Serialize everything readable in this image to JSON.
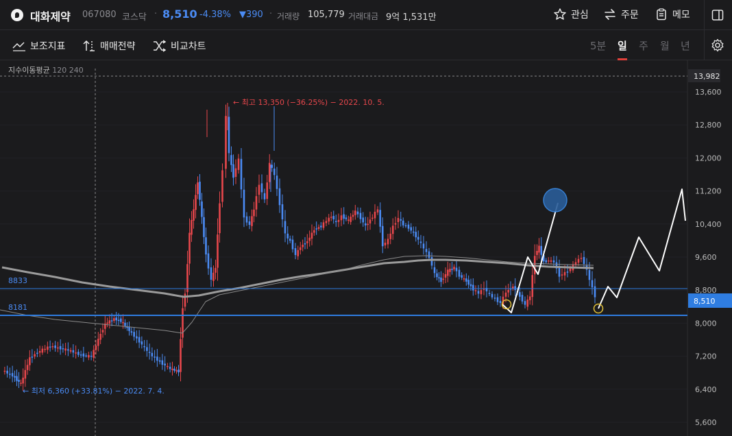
{
  "header": {
    "name": "대화제약",
    "code": "067080",
    "market": "코스닥",
    "price": "8,510",
    "change_rate": "-4.38%",
    "change": "▼390",
    "volume_label": "거래량",
    "volume": "105,779",
    "amount_label": "거래대금",
    "amount": "9억 1,531만",
    "favorite_label": "관심",
    "order_label": "주문",
    "memo_label": "메모"
  },
  "toolbar": {
    "indicator_label": "보조지표",
    "strategy_label": "매매전략",
    "compare_label": "비교차트",
    "periods": [
      "5분",
      "일",
      "주",
      "월",
      "년"
    ],
    "active_period": "일"
  },
  "indicator": {
    "name": "지수이동평균",
    "params": "120 240"
  },
  "chart_data": {
    "type": "candlestick",
    "y_ticks": [
      "13,600",
      "12,800",
      "12,000",
      "11,200",
      "10,400",
      "9,600",
      "8,800",
      "8,000",
      "7,200",
      "6,400",
      "5,600"
    ],
    "ylim": [
      5600,
      13982
    ],
    "current_price_tag": "8,510",
    "top_price_tag": "13,982",
    "high_annotation": "← 최고 13,350 (−36.25%) − 2022. 10. 5.",
    "low_annotation": "← 최저 6,360 (+33.81%) − 2022. 7. 4.",
    "horizontal_lines": [
      {
        "label": "8833",
        "value": 8833
      },
      {
        "label": "8181",
        "value": 8181
      }
    ],
    "series": [
      {
        "name": "EMA120",
        "type": "line",
        "color": "#9b9b9b"
      },
      {
        "name": "EMA240",
        "type": "line",
        "color": "#8a8a8a"
      }
    ],
    "colors": {
      "up": "#e8474c",
      "down": "#4b8cf5",
      "hline": "#2f7de1",
      "drawing": "#ffffff"
    }
  }
}
